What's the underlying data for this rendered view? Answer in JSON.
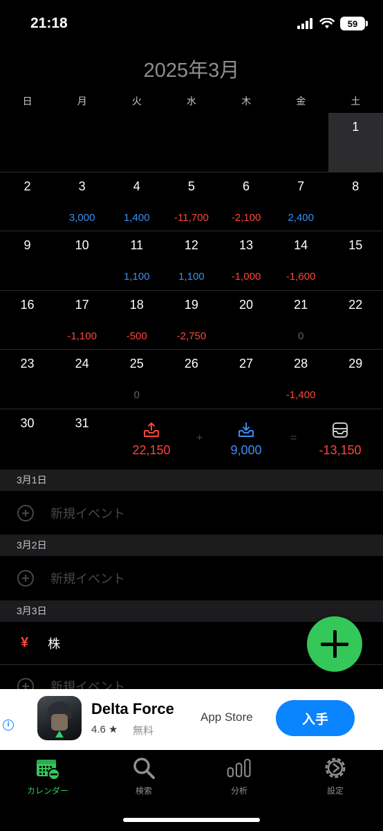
{
  "status": {
    "time": "21:18",
    "battery": "59"
  },
  "month_title": "2025年3月",
  "weekdays": [
    "日",
    "月",
    "火",
    "水",
    "木",
    "金",
    "土"
  ],
  "weeks": [
    [
      {
        "d": "",
        "a": ""
      },
      {
        "d": "",
        "a": ""
      },
      {
        "d": "",
        "a": ""
      },
      {
        "d": "",
        "a": ""
      },
      {
        "d": "",
        "a": ""
      },
      {
        "d": "",
        "a": ""
      },
      {
        "d": "1",
        "a": "",
        "selected": true
      }
    ],
    [
      {
        "d": "2",
        "a": ""
      },
      {
        "d": "3",
        "a": "3,000",
        "k": "pos"
      },
      {
        "d": "4",
        "a": "1,400",
        "k": "pos"
      },
      {
        "d": "5",
        "a": "-11,700",
        "k": "neg"
      },
      {
        "d": "6",
        "a": "-2,100",
        "k": "neg"
      },
      {
        "d": "7",
        "a": "2,400",
        "k": "pos"
      },
      {
        "d": "8",
        "a": ""
      }
    ],
    [
      {
        "d": "9",
        "a": ""
      },
      {
        "d": "10",
        "a": ""
      },
      {
        "d": "11",
        "a": "1,100",
        "k": "pos"
      },
      {
        "d": "12",
        "a": "1,100",
        "k": "pos"
      },
      {
        "d": "13",
        "a": "-1,000",
        "k": "neg"
      },
      {
        "d": "14",
        "a": "-1,600",
        "k": "neg"
      },
      {
        "d": "15",
        "a": ""
      }
    ],
    [
      {
        "d": "16",
        "a": ""
      },
      {
        "d": "17",
        "a": "-1,100",
        "k": "neg"
      },
      {
        "d": "18",
        "a": "-500",
        "k": "neg"
      },
      {
        "d": "19",
        "a": "-2,750",
        "k": "neg"
      },
      {
        "d": "20",
        "a": ""
      },
      {
        "d": "21",
        "a": "0",
        "k": "zero"
      },
      {
        "d": "22",
        "a": ""
      }
    ],
    [
      {
        "d": "23",
        "a": ""
      },
      {
        "d": "24",
        "a": ""
      },
      {
        "d": "25",
        "a": "0",
        "k": "zero"
      },
      {
        "d": "26",
        "a": ""
      },
      {
        "d": "27",
        "a": ""
      },
      {
        "d": "28",
        "a": "-1,400",
        "k": "neg"
      },
      {
        "d": "29",
        "a": ""
      }
    ],
    [
      {
        "d": "30",
        "a": ""
      },
      {
        "d": "31",
        "a": ""
      }
    ]
  ],
  "summary": {
    "expense": "22,150",
    "plus": "+",
    "income": "9,000",
    "equals": "=",
    "total": "-13,150"
  },
  "sections": [
    {
      "header": "3月1日",
      "new_event": "新規イベント"
    },
    {
      "header": "3月2日",
      "new_event": "新規イベント"
    },
    {
      "header": "3月3日",
      "event_name": "株",
      "event_icon": "¥",
      "new_event": "新規イベント"
    }
  ],
  "ad": {
    "app_name": "Delta Force",
    "rating": "4.6 ★",
    "price": "無料",
    "store": "App Store",
    "button": "入手",
    "info": "i"
  },
  "tabs": [
    {
      "label": "カレンダー",
      "icon": "calendar-icon",
      "active": true
    },
    {
      "label": "検索",
      "icon": "search-icon"
    },
    {
      "label": "分析",
      "icon": "chart-icon"
    },
    {
      "label": "設定",
      "icon": "gear-icon"
    }
  ],
  "colors": {
    "positive": "#3a8ef6",
    "negative": "#ff453a",
    "accent": "#34c759",
    "ad_button": "#0a84ff"
  }
}
